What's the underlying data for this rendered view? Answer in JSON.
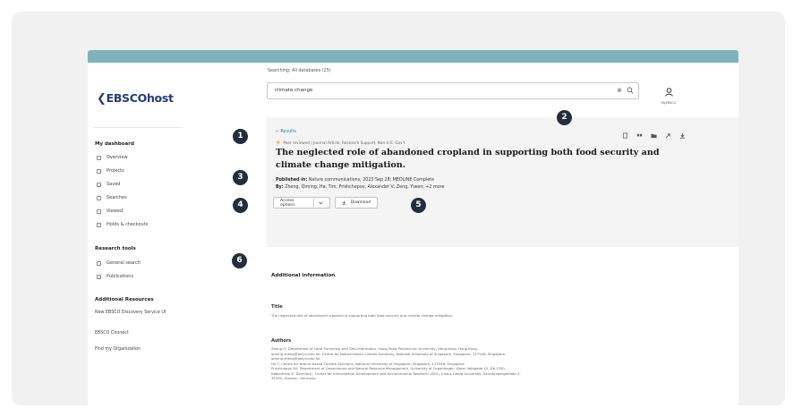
{
  "app": {
    "logo": "EBSCOhost",
    "logo_mark": "❮"
  },
  "sidebar": {
    "dashboard_heading": "My dashboard",
    "dashboard_items": [
      {
        "label": "Overview",
        "icon": "overview-icon"
      },
      {
        "label": "Projects",
        "icon": "projects-icon"
      },
      {
        "label": "Saved",
        "icon": "saved-icon"
      },
      {
        "label": "Searches",
        "icon": "searches-icon"
      },
      {
        "label": "Viewed",
        "icon": "viewed-icon"
      },
      {
        "label": "Holds & checkouts",
        "icon": "holds-icon"
      }
    ],
    "tools_heading": "Research tools",
    "tools_items": [
      {
        "label": "General search",
        "icon": "search-icon"
      },
      {
        "label": "Publications",
        "icon": "publications-icon"
      }
    ],
    "resources_heading": "Additional Resources",
    "resources_items": [
      "New EBSCO Discovery Service UI",
      "EBSCO Connect",
      "Find my Organization"
    ]
  },
  "search": {
    "scope_label": "Searching: All databases (25)",
    "query": "climate change",
    "clear_glyph": "⊗",
    "user_caption": "MyEBSCO"
  },
  "record": {
    "back_label": "← Results",
    "meta": "Peer reviewed | Journal Article, Research Support, Non-U.S. Gov't",
    "title": "The neglected role of abandoned cropland in supporting both food security and climate change mitigation.",
    "published_label": "Published in:",
    "published_value": "Nature communications, 2023 Sep 28; MEDLINE Complete",
    "by_label": "By:",
    "authors": "Zheng, Qiming; Ha, Tim; Prishchepov, Alexander V; Zeng, Yiwen; +2 more",
    "access_button": "Access options",
    "download_button": "Download"
  },
  "additional": {
    "heading": "Additional information",
    "title_heading": "Title",
    "title_text": "The neglected role of abandoned cropland in supporting both food security and climate change mitigation.",
    "authors_heading": "Authors",
    "authors_lines": [
      "Zheng Q; Department of Land Surveying and Geo-Informatics, Hong Kong Polytechnic University, Hong Kong, Hong Kong.",
      "qiming.zheng@polyu.edu.hk; Centre for Nature-based Climate Solutions, National University of Singapore, Singapore, 117546, Singapore.",
      "qiming.zheng@polyu.edu.hk.",
      "Ha T; Centre for Nature-based Climate Solutions, National University of Singapore, Singapore, 117546, Singapore.",
      "Prishchepov AV; Department of Geosciences and Natural Resource Management, University of Copenhagen, Øster Voldgade 10, DK-1350,",
      "København K, Denmark.; Center for International Development and Environmental Research (ZEU), Justus Liebig University, Senckenbergstraße 3,",
      "35390, Giessen, Germany."
    ]
  },
  "callouts": [
    "1",
    "2",
    "3",
    "4",
    "5",
    "6"
  ],
  "colors": {
    "topbar": "#7fb2bb",
    "badge": "#252d3a",
    "logo": "#243b7a",
    "link": "#3b7dbb",
    "star": "#e7a93a"
  }
}
